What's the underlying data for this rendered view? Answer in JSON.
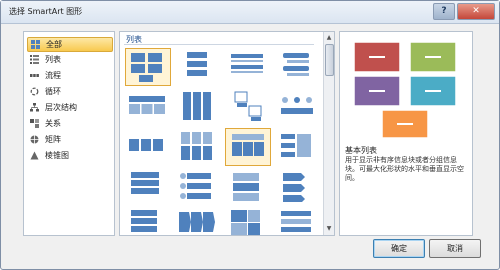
{
  "window": {
    "title": "选择 SmartArt 图形",
    "help_icon": "help-icon",
    "close_icon": "close-icon"
  },
  "categories": [
    {
      "label": "全部",
      "icon": "all-icon",
      "selected": true
    },
    {
      "label": "列表",
      "icon": "list-icon"
    },
    {
      "label": "流程",
      "icon": "process-icon"
    },
    {
      "label": "循环",
      "icon": "cycle-icon"
    },
    {
      "label": "层次结构",
      "icon": "hierarchy-icon"
    },
    {
      "label": "关系",
      "icon": "relationship-icon"
    },
    {
      "label": "矩阵",
      "icon": "matrix-icon"
    },
    {
      "label": "棱锥图",
      "icon": "pyramid-icon"
    }
  ],
  "layouts": {
    "header": "列表"
  },
  "preview": {
    "colors": [
      "#c0504d",
      "#9bbb59",
      "#8064a2",
      "#4bacc6",
      "#f79646"
    ],
    "title": "基本列表",
    "description": "用于显示非有序信息块或者分组信息块。可最大化形状的水平和垂直显示空间。"
  },
  "buttons": {
    "ok": "确定",
    "cancel": "取消"
  }
}
